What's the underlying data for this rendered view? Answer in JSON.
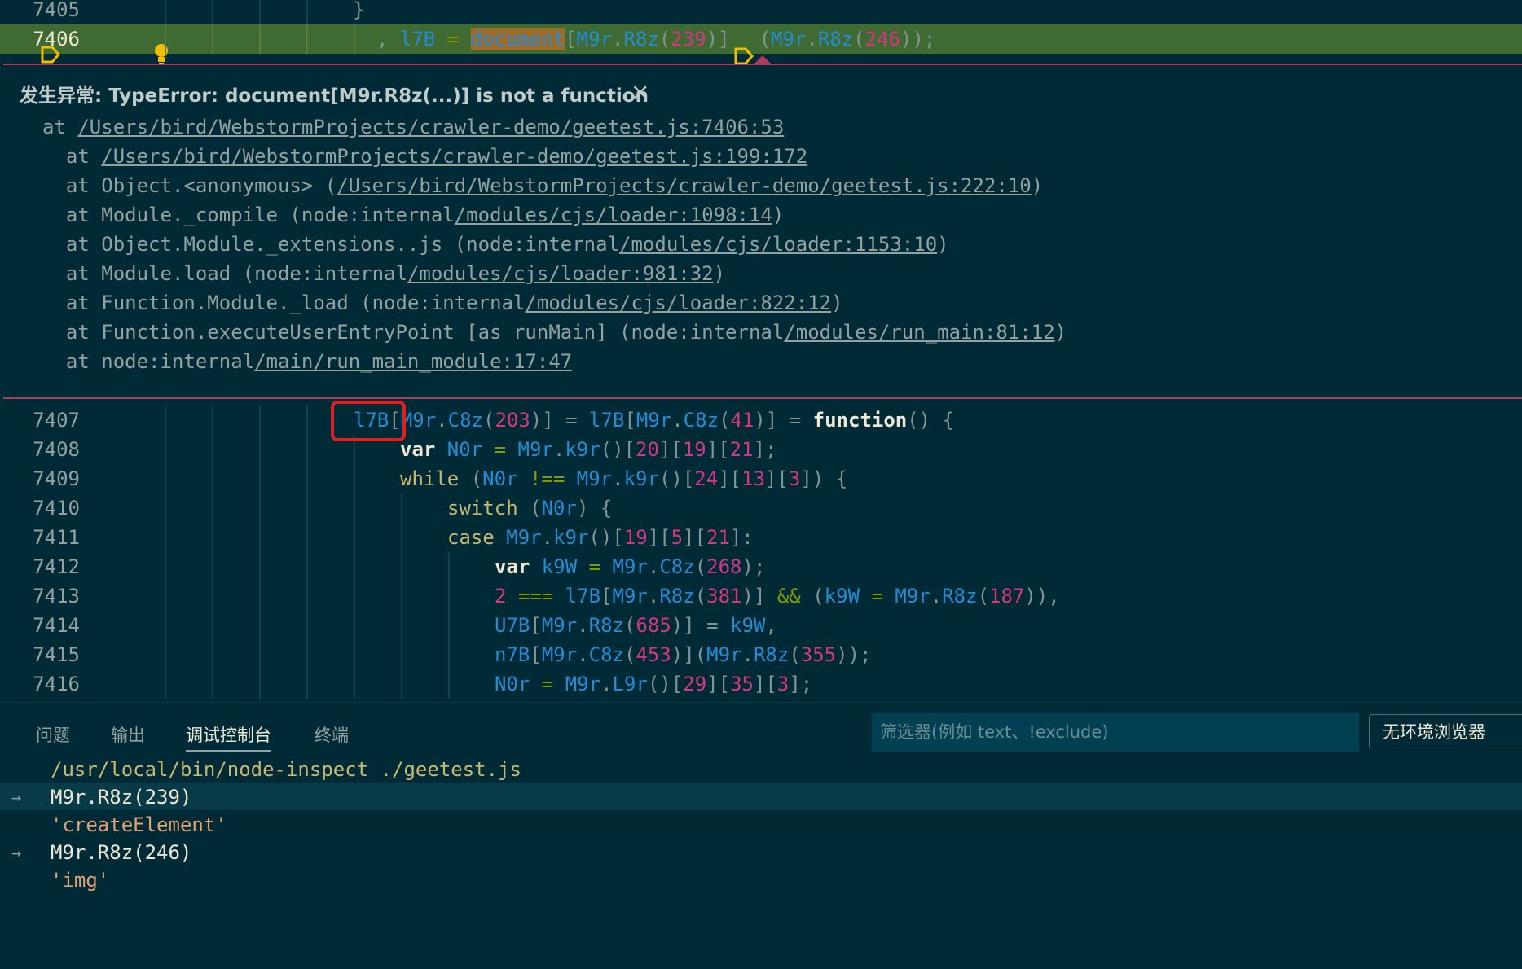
{
  "editor": {
    "top_line": {
      "num": "7405",
      "code": "}"
    },
    "highlight_line": {
      "num": "7406",
      "prefix": ", ",
      "var": "l7B",
      "eq": " = ",
      "document": "document",
      "open": "[",
      "obj": "M9r",
      "dot": ".",
      "fn": "R8z",
      "paren_open": "(",
      "arg1": "239",
      "close1": ")]",
      "call_open": "(",
      "arg2": "246",
      "close2": "));"
    },
    "exception": {
      "title": "发生异常: TypeError: document[M9r.R8z(...)] is not a function",
      "close": "×",
      "stack": [
        {
          "pre": "at ",
          "link": "/Users/bird/WebstormProjects/crawler-demo/geetest.js:7406:53",
          "post": ""
        },
        {
          "pre": "  at ",
          "link": "/Users/bird/WebstormProjects/crawler-demo/geetest.js:199:172",
          "post": ""
        },
        {
          "pre": "  at Object.<anonymous> (",
          "link": "/Users/bird/WebstormProjects/crawler-demo/geetest.js:222:10",
          "post": ")"
        },
        {
          "pre": "  at Module._compile (node:internal",
          "link": "/modules/cjs/loader:1098:14",
          "post": ")"
        },
        {
          "pre": "  at Object.Module._extensions..js (node:internal",
          "link": "/modules/cjs/loader:1153:10",
          "post": ")"
        },
        {
          "pre": "  at Module.load (node:internal",
          "link": "/modules/cjs/loader:981:32",
          "post": ")"
        },
        {
          "pre": "  at Function.Module._load (node:internal",
          "link": "/modules/cjs/loader:822:12",
          "post": ")"
        },
        {
          "pre": "  at Function.executeUserEntryPoint [as runMain] (node:internal",
          "link": "/modules/run_main:81:12",
          "post": ")"
        },
        {
          "pre": "  at node:internal",
          "link": "/main/run_main_module:17:47",
          "post": ""
        }
      ]
    },
    "lines": [
      {
        "num": "7407"
      },
      {
        "num": "7408"
      },
      {
        "num": "7409"
      },
      {
        "num": "7410"
      },
      {
        "num": "7411"
      },
      {
        "num": "7412"
      },
      {
        "num": "7413"
      },
      {
        "num": "7414"
      },
      {
        "num": "7415"
      },
      {
        "num": "7416"
      }
    ],
    "code": {
      "l7407": {
        "a": "l7B",
        "b": "[",
        "c": "M9r",
        "d": ".",
        "e": "C8z",
        "f": "(",
        "g": "203",
        "h": ")] = ",
        "i": "l7B",
        "j": "[",
        "k": "M9r",
        "l": ".",
        "m": "C8z",
        "n": "(",
        "o": "41",
        "p": ")] = ",
        "q": "function",
        "r": "() {"
      },
      "l7408": {
        "a": "var ",
        "b": "N0r",
        "c": " = ",
        "d": "M9r",
        "e": ".",
        "f": "k9r",
        "g": "()[",
        "h": "20",
        "i": "][",
        "j": "19",
        "k": "][",
        "l": "21",
        "m": "];"
      },
      "l7409": {
        "a": "while",
        "b": " (",
        "c": "N0r",
        "d": " !== ",
        "e": "M9r",
        "f": ".",
        "g": "k9r",
        "h": "()[",
        "i": "24",
        "j": "][",
        "k": "13",
        "l": "][",
        "m": "3",
        "n": "]) {"
      },
      "l7410": {
        "a": "switch",
        "b": " (",
        "c": "N0r",
        "d": ") {"
      },
      "l7411": {
        "a": "case ",
        "b": "M9r",
        "c": ".",
        "d": "k9r",
        "e": "()[",
        "f": "19",
        "g": "][",
        "h": "5",
        "i": "][",
        "j": "21",
        "k": "]:"
      },
      "l7412": {
        "a": "var ",
        "b": "k9W",
        "c": " = ",
        "d": "M9r",
        "e": ".",
        "f": "C8z",
        "g": "(",
        "h": "268",
        "i": ");"
      },
      "l7413": {
        "a": "2",
        "b": " === ",
        "c": "l7B",
        "d": "[",
        "e": "M9r",
        "f": ".",
        "g": "R8z",
        "h": "(",
        "i": "381",
        "j": ")] ",
        "k": "&&",
        "l": " (",
        "m": "k9W",
        "n": " = ",
        "o": "M9r",
        "p": ".",
        "q": "R8z",
        "r": "(",
        "s": "187",
        "t": ")),"
      },
      "l7414": {
        "a": "U7B",
        "b": "[",
        "c": "M9r",
        "d": ".",
        "e": "R8z",
        "f": "(",
        "g": "685",
        "h": ")] = ",
        "i": "k9W",
        "j": ","
      },
      "l7415": {
        "a": "n7B",
        "b": "[",
        "c": "M9r",
        "d": ".",
        "e": "C8z",
        "f": "(",
        "g": "453",
        "h": ")](",
        "i": "M9r",
        "j": ".",
        "k": "R8z",
        "l": "(",
        "m": "355",
        "n": "));"
      },
      "l7416": {
        "a": "N0r",
        "b": " = ",
        "c": "M9r",
        "d": ".",
        "e": "L9r",
        "f": "()[",
        "g": "29",
        "h": "][",
        "i": "35",
        "j": "][",
        "k": "3",
        "l": "];"
      }
    }
  },
  "panel": {
    "tabs": [
      "问题",
      "输出",
      "调试控制台",
      "终端"
    ],
    "active_tab": "调试控制台",
    "filter_placeholder": "筛选器(例如 text、!exclude)",
    "env_select": "无环境浏览器",
    "console": [
      {
        "kind": "path",
        "text": "/usr/local/bin/node-inspect ./geetest.js"
      },
      {
        "kind": "input",
        "text": "M9r.R8z(239)"
      },
      {
        "kind": "output",
        "text": "'createElement'"
      },
      {
        "kind": "input",
        "text": "M9r.R8z(246)"
      },
      {
        "kind": "output",
        "text": "'img'"
      }
    ]
  },
  "colors": {
    "background": "#002b36",
    "highlight_line": "#3f6b33",
    "peek_border": "#ae3a5c",
    "annotation_box": "#e02020"
  }
}
